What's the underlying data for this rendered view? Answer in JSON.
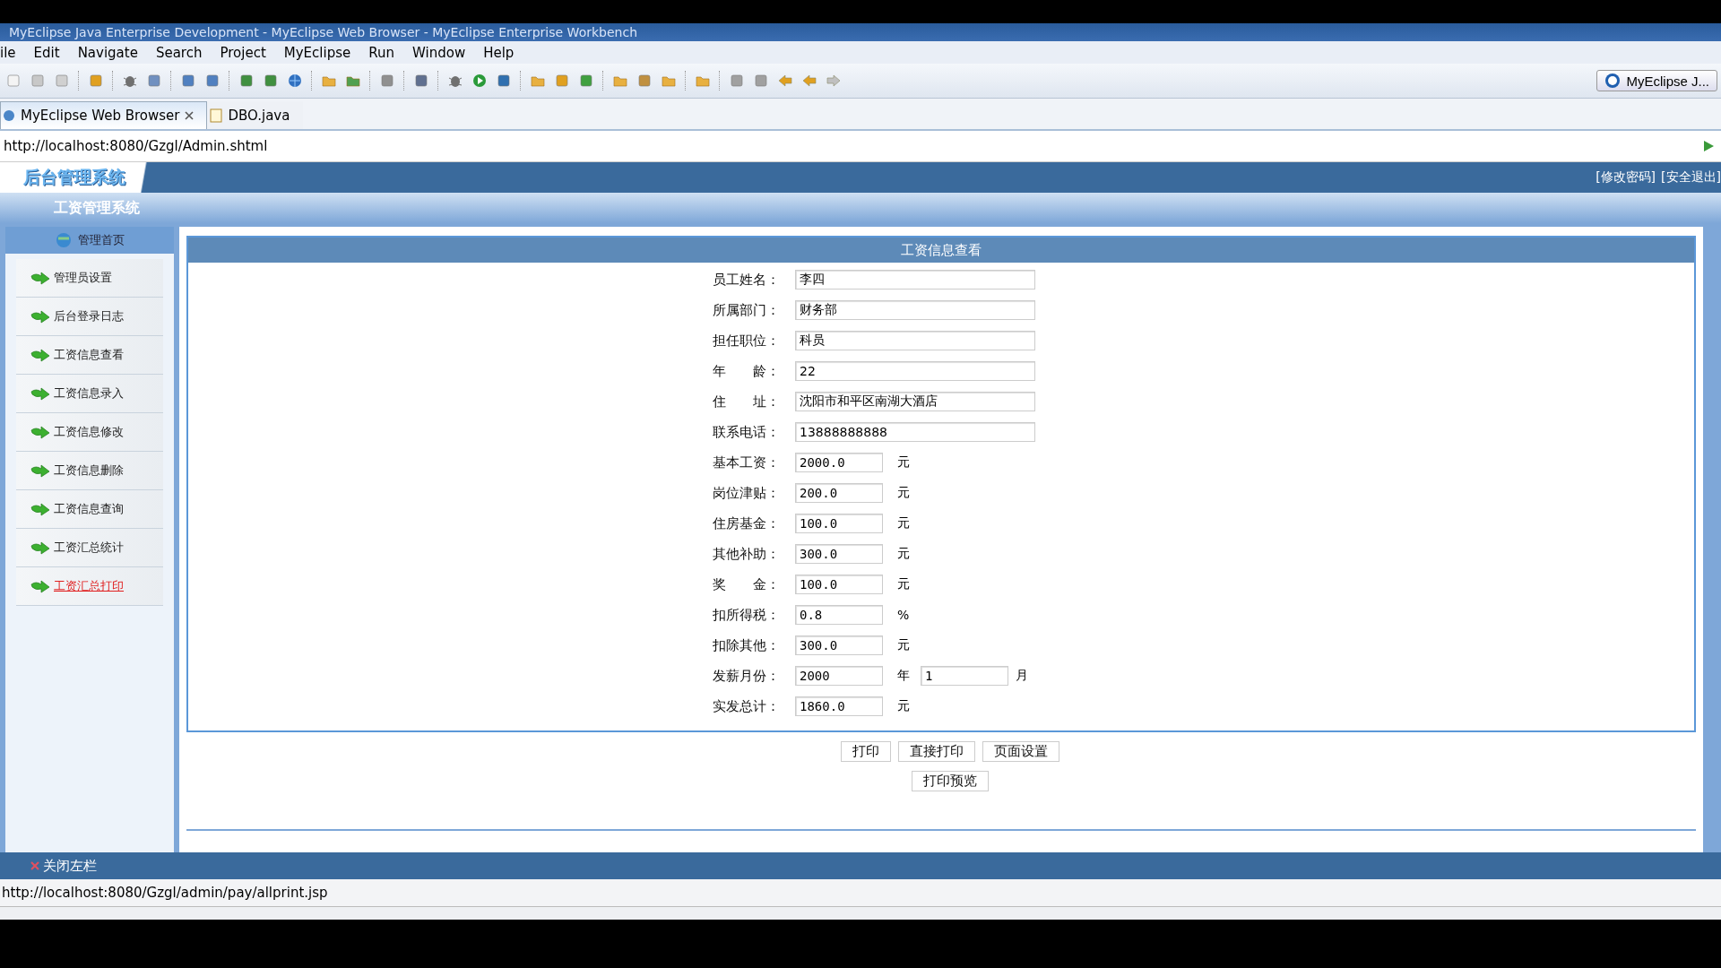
{
  "window": {
    "title": "MyEclipse Java Enterprise Development - MyEclipse Web Browser - MyEclipse Enterprise Workbench"
  },
  "menu": [
    "ile",
    "Edit",
    "Navigate",
    "Search",
    "Project",
    "MyEclipse",
    "Run",
    "Window",
    "Help"
  ],
  "perspective": {
    "label": "MyEclipse J..."
  },
  "tabs": [
    {
      "label": "MyEclipse Web Browser",
      "selected": true,
      "closable": true
    },
    {
      "label": "DBO.java",
      "selected": false,
      "closable": false
    }
  ],
  "address": {
    "value": "http://localhost:8080/Gzgl/Admin.shtml"
  },
  "page": {
    "logo": "后台管理系统",
    "links": [
      "[修改密码]",
      "[安全退出]"
    ],
    "subtitle": "工资管理系统",
    "home": "管理首页",
    "nav": [
      {
        "label": "管理员设置",
        "selected": false
      },
      {
        "label": "后台登录日志",
        "selected": false
      },
      {
        "label": "工资信息查看",
        "selected": false
      },
      {
        "label": "工资信息录入",
        "selected": false
      },
      {
        "label": "工资信息修改",
        "selected": false
      },
      {
        "label": "工资信息删除",
        "selected": false
      },
      {
        "label": "工资信息查询",
        "selected": false
      },
      {
        "label": "工资汇总统计",
        "selected": false
      },
      {
        "label": "工资汇总打印",
        "selected": true
      }
    ],
    "panel_title": "工资信息查看",
    "fields": [
      {
        "kind": "wide",
        "label": "员工姓名：",
        "value": "李四"
      },
      {
        "kind": "wide",
        "label": "所属部门：",
        "value": "财务部"
      },
      {
        "kind": "wide",
        "label": "担任职位：",
        "value": "科员"
      },
      {
        "kind": "wide",
        "label": "年　　龄：",
        "value": "22"
      },
      {
        "kind": "wide",
        "label": "住　　址：",
        "value": "沈阳市和平区南湖大酒店"
      },
      {
        "kind": "wide",
        "label": "联系电话：",
        "value": "13888888888"
      },
      {
        "kind": "short",
        "label": "基本工资：",
        "value": "2000.0",
        "unit": "元"
      },
      {
        "kind": "short",
        "label": "岗位津贴：",
        "value": "200.0",
        "unit": "元"
      },
      {
        "kind": "short",
        "label": "住房基金：",
        "value": "100.0",
        "unit": "元"
      },
      {
        "kind": "short",
        "label": "其他补助：",
        "value": "300.0",
        "unit": "元"
      },
      {
        "kind": "short",
        "label": "奖　　金：",
        "value": "100.0",
        "unit": "元"
      },
      {
        "kind": "short",
        "label": "扣所得税：",
        "value": "0.8",
        "unit": "%"
      },
      {
        "kind": "short",
        "label": "扣除其他：",
        "value": "300.0",
        "unit": "元"
      },
      {
        "kind": "date",
        "label": "发薪月份：",
        "value": "2000",
        "unit": "年",
        "value2": "1",
        "unit2": "月"
      },
      {
        "kind": "short",
        "label": "实发总计：",
        "value": "1860.0",
        "unit": "元"
      }
    ],
    "buttons": [
      "打印",
      "直接打印",
      "页面设置"
    ],
    "preview_button": "打印预览",
    "close_sidebar": "关闭左栏"
  },
  "status_bar": {
    "url": "http://localhost:8080/Gzgl/admin/pay/allprint.jsp"
  }
}
